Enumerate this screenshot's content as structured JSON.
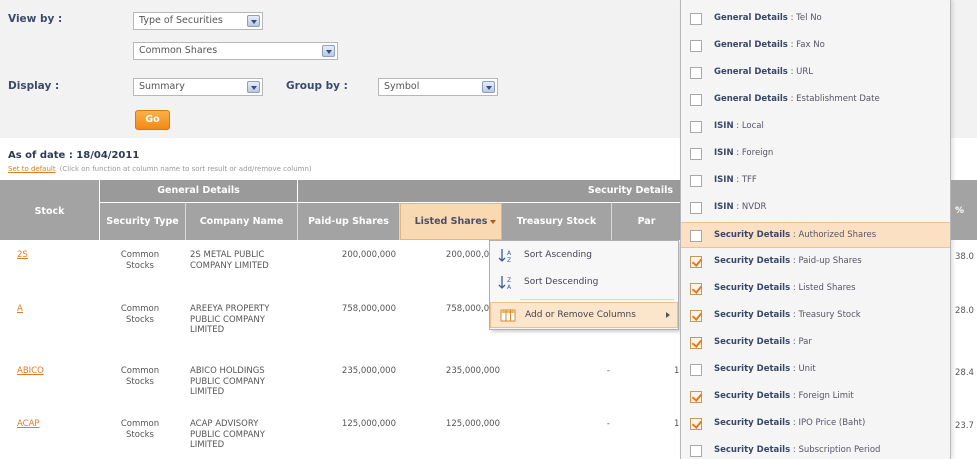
{
  "filters": {
    "view_by_label": "View by :",
    "view_by_value": "Type of Securities",
    "sub_value": "Common Shares",
    "display_label": "Display :",
    "display_value": "Summary",
    "group_by_label": "Group by :",
    "group_by_value": "Symbol",
    "go_label": "Go"
  },
  "as_of": "As of date : 18/04/2011",
  "set_default": {
    "link": "Set to default",
    "hint": "(Click on function at column name to sort result or add/remove column)"
  },
  "table": {
    "group_headers": [
      "General Details",
      "Security Details"
    ],
    "columns": [
      "Stock",
      "Security Type",
      "Company Name",
      "Paid-up Shares",
      "Listed Shares",
      "Treasury Stock",
      "Par"
    ],
    "rows": [
      {
        "stock": "2S",
        "type": "Common Stocks",
        "company": "2S METAL PUBLIC COMPANY LIMITED",
        "paid_up": "200,000,000",
        "listed": "200,000,000",
        "treasury": "",
        "par": "",
        "right": "38.0"
      },
      {
        "stock": "A",
        "type": "Common Stocks",
        "company": "AREEYA PROPERTY PUBLIC COMPANY LIMITED",
        "paid_up": "758,000,000",
        "listed": "758,000,000",
        "treasury": "",
        "par": "",
        "right": "28.0"
      },
      {
        "stock": "ABICO",
        "type": "Common Stocks",
        "company": "ABICO HOLDINGS PUBLIC COMPANY LIMITED",
        "paid_up": "235,000,000",
        "listed": "235,000,000",
        "treasury": "-",
        "par": "1",
        "right": "28.4"
      },
      {
        "stock": "ACAP",
        "type": "Common Stocks",
        "company": "ACAP ADVISORY PUBLIC COMPANY LIMITED",
        "paid_up": "125,000,000",
        "listed": "125,000,000",
        "treasury": "-",
        "par": "1",
        "right": "23.7"
      }
    ]
  },
  "context_menu": {
    "items": [
      "Sort Ascending",
      "Sort Descending",
      "Add or Remove Columns"
    ]
  },
  "column_chooser": {
    "items": [
      {
        "group": "General Details",
        "field": "Tel No",
        "checked": false,
        "highlight": false
      },
      {
        "group": "General Details",
        "field": "Fax No",
        "checked": false,
        "highlight": false
      },
      {
        "group": "General Details",
        "field": "URL",
        "checked": false,
        "highlight": false
      },
      {
        "group": "General Details",
        "field": "Establishment Date",
        "checked": false,
        "highlight": false
      },
      {
        "group": "ISIN",
        "field": "Local",
        "checked": false,
        "highlight": false
      },
      {
        "group": "ISIN",
        "field": "Foreign",
        "checked": false,
        "highlight": false
      },
      {
        "group": "ISIN",
        "field": "TFF",
        "checked": false,
        "highlight": false
      },
      {
        "group": "ISIN",
        "field": "NVDR",
        "checked": false,
        "highlight": false
      },
      {
        "group": "Security Details",
        "field": "Authorized Shares",
        "checked": false,
        "highlight": true
      },
      {
        "group": "Security Details",
        "field": "Paid-up Shares",
        "checked": true,
        "highlight": false
      },
      {
        "group": "Security Details",
        "field": "Listed Shares",
        "checked": true,
        "highlight": false
      },
      {
        "group": "Security Details",
        "field": "Treasury Stock",
        "checked": true,
        "highlight": false
      },
      {
        "group": "Security Details",
        "field": "Par",
        "checked": true,
        "highlight": false
      },
      {
        "group": "Security Details",
        "field": "Unit",
        "checked": false,
        "highlight": false
      },
      {
        "group": "Security Details",
        "field": "Foreign Limit",
        "checked": true,
        "highlight": false
      },
      {
        "group": "Security Details",
        "field": "IPO Price (Baht)",
        "checked": true,
        "highlight": false
      },
      {
        "group": "Security Details",
        "field": "Subscription Period",
        "checked": false,
        "highlight": false
      }
    ]
  },
  "right_edge": {
    "header": "%"
  },
  "colors": {
    "accent": "#e17a24",
    "header_gray": "#9a9a9a",
    "highlight": "#fbe0c3",
    "label_navy": "#3b4a6b"
  }
}
